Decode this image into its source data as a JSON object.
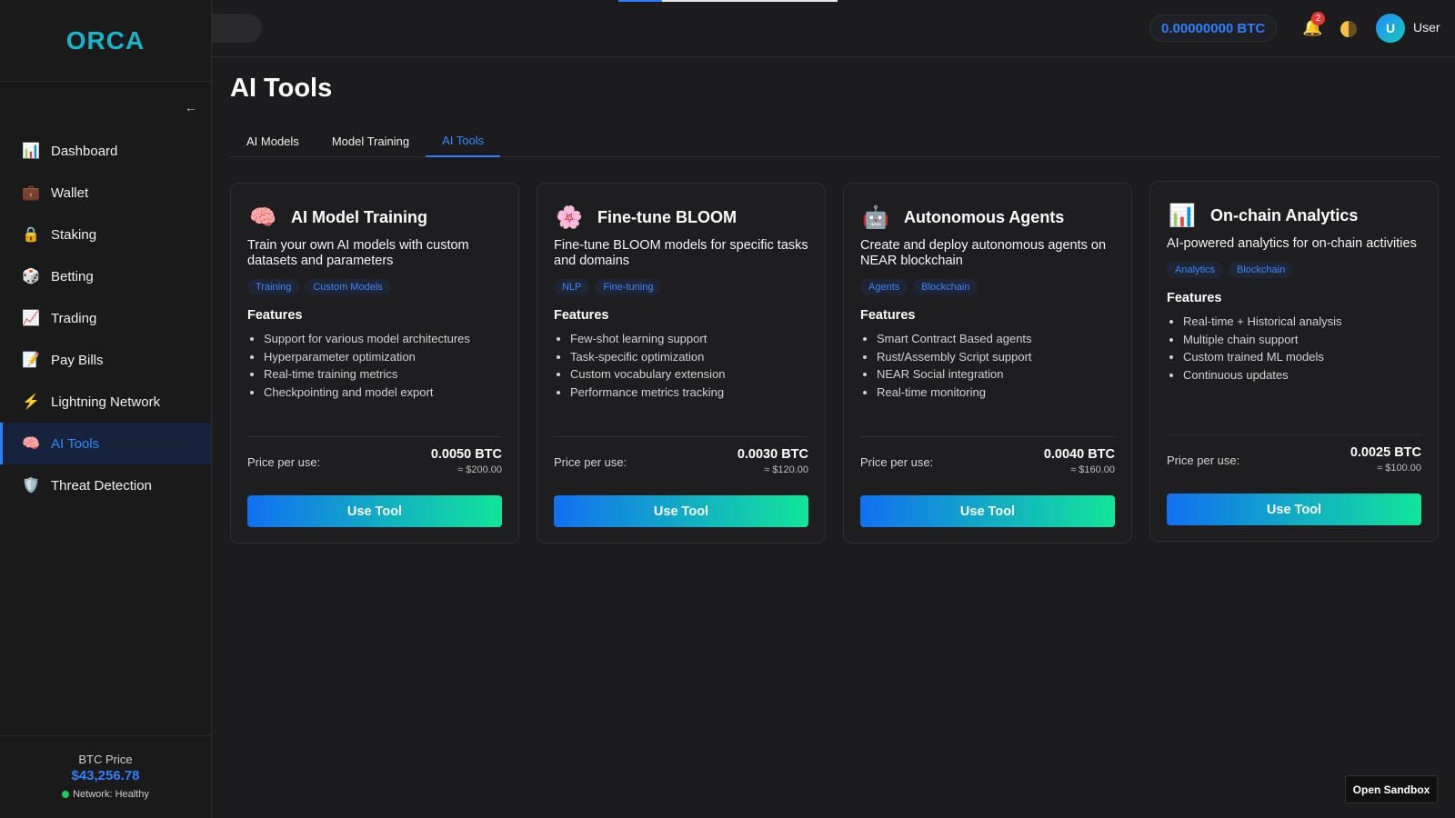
{
  "sidebar": {
    "logo": "ORCA",
    "collapse_icon": "←",
    "items": [
      {
        "label": "Dashboard",
        "icon": "📊"
      },
      {
        "label": "Wallet",
        "icon": "💼"
      },
      {
        "label": "Staking",
        "icon": "🔒"
      },
      {
        "label": "Betting",
        "icon": "🎲"
      },
      {
        "label": "Trading",
        "icon": "📈"
      },
      {
        "label": "Pay Bills",
        "icon": "📝"
      },
      {
        "label": "Lightning Network",
        "icon": "⚡"
      },
      {
        "label": "AI Tools",
        "icon": "🧠",
        "active": true
      },
      {
        "label": "Threat Detection",
        "icon": "🛡️"
      }
    ],
    "footer": {
      "btc_label": "BTC Price",
      "btc_value": "$43,256.78",
      "network_status": "Network: Healthy"
    }
  },
  "header": {
    "btc_balance": "0.00000000 BTC",
    "notification_count": "2",
    "user_initial": "U",
    "user_name": "User"
  },
  "main": {
    "title": "AI Tools",
    "tabs": [
      {
        "label": "AI Models"
      },
      {
        "label": "Model Training"
      },
      {
        "label": "AI Tools",
        "active": true
      }
    ],
    "cards": [
      {
        "icon": "🧠",
        "title": "AI Model Training",
        "description": "Train your own AI models with custom datasets and parameters",
        "tags": [
          "Training",
          "Custom Models"
        ],
        "features_title": "Features",
        "features": [
          "Support for various model architectures",
          "Hyperparameter optimization",
          "Real-time training metrics",
          "Checkpointing and model export"
        ],
        "price_label": "Price per use:",
        "price_btc": "0.0050 BTC",
        "price_usd": "≈ $200.00",
        "button": "Use Tool"
      },
      {
        "icon": "🌸",
        "title": "Fine-tune BLOOM",
        "description": "Fine-tune BLOOM models for specific tasks and domains",
        "tags": [
          "NLP",
          "Fine-tuning"
        ],
        "features_title": "Features",
        "features": [
          "Few-shot learning support",
          "Task-specific optimization",
          "Custom vocabulary extension",
          "Performance metrics tracking"
        ],
        "price_label": "Price per use:",
        "price_btc": "0.0030 BTC",
        "price_usd": "≈ $120.00",
        "button": "Use Tool"
      },
      {
        "icon": "🤖",
        "title": "Autonomous Agents",
        "description": "Create and deploy autonomous agents on NEAR blockchain",
        "tags": [
          "Agents",
          "Blockchain"
        ],
        "features_title": "Features",
        "features": [
          "Smart Contract Based agents",
          "Rust/Assembly Script support",
          "NEAR Social integration",
          "Real-time monitoring"
        ],
        "price_label": "Price per use:",
        "price_btc": "0.0040 BTC",
        "price_usd": "≈ $160.00",
        "button": "Use Tool"
      },
      {
        "icon": "📊",
        "title": "On-chain Analytics",
        "description": "AI-powered analytics for on-chain activities",
        "tags": [
          "Analytics",
          "Blockchain"
        ],
        "features_title": "Features",
        "features": [
          "Real-time + Historical analysis",
          "Multiple chain support",
          "Custom trained ML models",
          "Continuous updates"
        ],
        "price_label": "Price per use:",
        "price_btc": "0.0025 BTC",
        "price_usd": "≈ $100.00",
        "button": "Use Tool"
      }
    ]
  },
  "sandbox_button": "Open Sandbox"
}
